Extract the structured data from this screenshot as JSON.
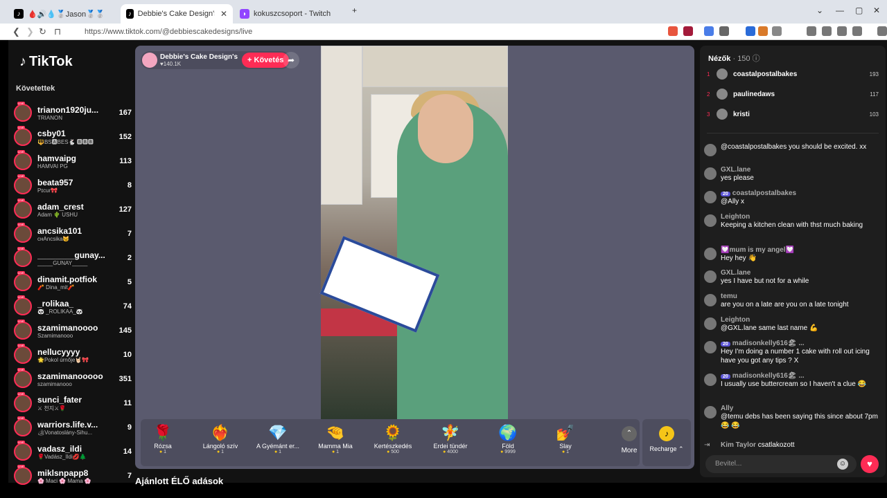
{
  "browser": {
    "tabs": [
      {
        "label": "🩸🔊💧🥈Jason🥈🥈🩸 (@jason_san",
        "favicon": "tiktok"
      },
      {
        "label": "Debbie's Cake Design's (@de",
        "favicon": "tiktok"
      },
      {
        "label": "kokuszcsoport - Twitch",
        "favicon": "twitch"
      }
    ],
    "url": "https://www.tiktok.com/@debbiescakedesigns/live"
  },
  "sidebar": {
    "logo": "TikTok",
    "heading": "Követettek",
    "following": [
      {
        "name": "trianon1920ju...",
        "sub": "TRIANON",
        "count": "167"
      },
      {
        "name": "csby01",
        "sub": "🔱BS🅰BES🐇 🅱🅱🅱",
        "count": "152"
      },
      {
        "name": "hamvaipg",
        "sub": "HAMVAI PG",
        "count": "113"
      },
      {
        "name": "beata957",
        "sub": "Pɪcur🎀",
        "count": "8"
      },
      {
        "name": "adam_crest",
        "sub": "Adam 🌵 USHU",
        "count": "127"
      },
      {
        "name": "ancsika101",
        "sub": "cʜAncsika😼",
        "count": "7"
      },
      {
        "name": "________gunay...",
        "sub": "_____GUNAY_____",
        "count": "2"
      },
      {
        "name": "dinamit.potfiok",
        "sub": "🧨 Dina_mit🧨",
        "count": "5"
      },
      {
        "name": "_rolikaa_",
        "sub": "🐼 _ROLIKAA_🐼",
        "count": "74"
      },
      {
        "name": "szamimanoooo",
        "sub": "Szamimanooo",
        "count": "145"
      },
      {
        "name": "nellucyyyy",
        "sub": "🌟Pokol úrnője🤘🏻🎀",
        "count": "10"
      },
      {
        "name": "szamimanooooo",
        "sub": "szamimanooo",
        "count": "351"
      },
      {
        "name": "sunci_fater",
        "sub": "⚔ 천지⚔🌹",
        "count": "11"
      },
      {
        "name": "warriors.life.v...",
        "sub": "🏕Vonatoslány-Sihu...",
        "count": "9"
      },
      {
        "name": "vadasz_ildi",
        "sub": "🌹Vadász_Ildi💋🌲",
        "count": "14"
      },
      {
        "name": "miklsnpapp8",
        "sub": "🌸 Maci 🌸 Mama 🌸",
        "count": "7"
      }
    ]
  },
  "host": {
    "name": "Debbie's Cake Design's",
    "likes": "♥140.1K",
    "follow_label": "+ Követés"
  },
  "gifts": [
    {
      "icon": "🌹",
      "label": "Rózsa",
      "price": "1"
    },
    {
      "icon": "❤️‍🔥",
      "label": "Lángoló szív",
      "price": "1"
    },
    {
      "icon": "💎",
      "label": "A Gyémánt er...",
      "price": "1"
    },
    {
      "icon": "🤏",
      "label": "Mamma Mia",
      "price": "1"
    },
    {
      "icon": "🌻",
      "label": "Kertészkedés",
      "price": "500"
    },
    {
      "icon": "🧚",
      "label": "Erdei tündér",
      "price": "4000"
    },
    {
      "icon": "🌍",
      "label": "Föld",
      "price": "9999"
    },
    {
      "icon": "💅",
      "label": "Slay",
      "price": "1"
    }
  ],
  "more_label": "More",
  "recharge_label": "Recharge ⌃",
  "below_title": "Ajánlott ÉLŐ adások",
  "viewers": {
    "title": "Nézők",
    "count": "· 150",
    "top": [
      {
        "rank": "1",
        "name": "coastalpostalbakes",
        "score": "193"
      },
      {
        "rank": "2",
        "name": "paulinedaws",
        "score": "117"
      },
      {
        "rank": "3",
        "name": "kristi",
        "score": "103"
      }
    ]
  },
  "chat": [
    {
      "user": "",
      "text": "@coastalpostalbakes you should be excited. xx",
      "badge": ""
    },
    {
      "user": "GXL.lane",
      "text": "yes please",
      "badge": ""
    },
    {
      "user": "coastalpostalbakes",
      "text": "@Ally x",
      "badge": "20"
    },
    {
      "user": "Leighton",
      "text": "Keeping a kitchen clean with thst much baking",
      "badge": ""
    },
    {
      "user": "💟mum is my angel💟",
      "text": "Hey hey 👋",
      "badge": ""
    },
    {
      "user": "GXL.lane",
      "text": "yes I have but not for a while",
      "badge": ""
    },
    {
      "user": "temu",
      "text": "are you on a late are you on a late tonight",
      "badge": ""
    },
    {
      "user": "Leighton",
      "text": "@GXL.lane same last name 💪",
      "badge": ""
    },
    {
      "user": "madisonkelly616🏖 ...",
      "text": "Hey I'm doing a number 1 cake with roll out icing have you got any tips ? X",
      "badge": "20"
    },
    {
      "user": "madisonkelly616🏖 ...",
      "text": "I usually use buttercream so I haven't a clue 😂",
      "badge": "20"
    },
    {
      "user": "Ally",
      "text": "@temu debs has been saying this since about 7pm 😂 😂",
      "badge": ""
    }
  ],
  "join": {
    "user": "Kim Taylor",
    "text": "csatlakozott"
  },
  "input_placeholder": "Bevitel..."
}
